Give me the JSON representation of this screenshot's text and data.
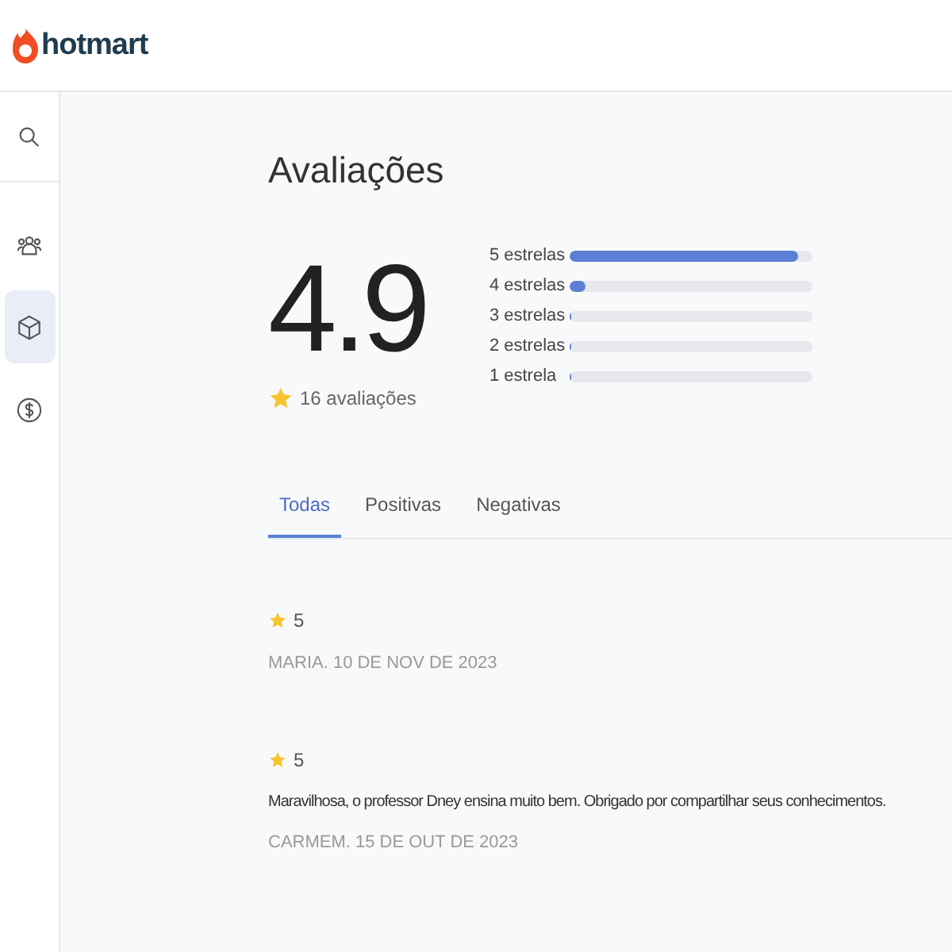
{
  "header": {
    "logo_text": "hotmart"
  },
  "sidebar": {
    "items": [
      {
        "kind": "search",
        "selected": false
      },
      {
        "kind": "people",
        "selected": false
      },
      {
        "kind": "box",
        "selected": true
      },
      {
        "kind": "dollar",
        "selected": false
      }
    ]
  },
  "page_title": "Avaliações",
  "summary": {
    "score": "4.9",
    "count": "16 avaliações"
  },
  "distribution": [
    {
      "label": "5 estrelas",
      "level": 0.94
    },
    {
      "label": "4 estrelas",
      "level": 0.06
    },
    {
      "label": "3 estrelas",
      "level": 0
    },
    {
      "label": "2 estrelas",
      "level": 0
    },
    {
      "label": "1 estrela",
      "level": 0
    }
  ],
  "tabs": [
    {
      "label": "Todas",
      "selected": true
    },
    {
      "label": "Positivas",
      "selected": false
    },
    {
      "label": "Negativas",
      "selected": false
    }
  ],
  "reviews": [
    {
      "rating": "5",
      "author_date": "MARIA. 10 DE NOV DE 2023"
    },
    {
      "rating": "5",
      "comment": "Maravilhosa, o professor Dney ensina muito bem. Obrigado por compartilhar seus conhecimentos.",
      "author_date": "CARMEM. 15 DE OUT DE 2023"
    }
  ]
}
